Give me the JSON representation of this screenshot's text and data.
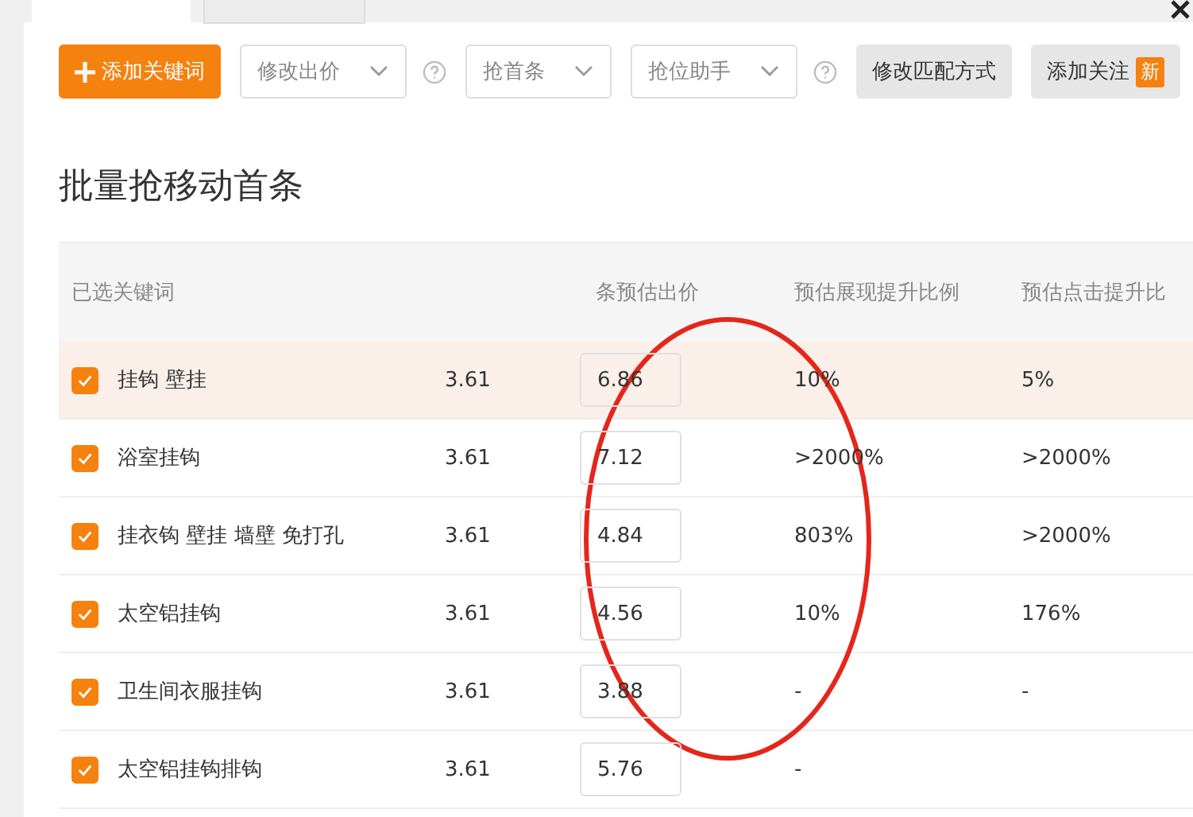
{
  "toolbar": {
    "add_button": "添加关键词",
    "dropdowns": [
      {
        "label": "修改出价",
        "help": true
      },
      {
        "label": "抢首条",
        "help": false
      },
      {
        "label": "抢位助手",
        "help": true
      }
    ],
    "buttons": [
      {
        "label": "修改匹配方式"
      },
      {
        "label": "添加关注",
        "badge": "新"
      }
    ]
  },
  "title": "批量抢移动首条",
  "table": {
    "columns": [
      "已选关键词",
      "",
      "条预估出价",
      "预估展现提升比例",
      "预估点击提升比"
    ],
    "rows": [
      {
        "keyword": "挂钩 壁挂",
        "price": "3.61",
        "bid": "6.86",
        "impression": "10%",
        "click": "5%",
        "checked": true,
        "highlighted": true
      },
      {
        "keyword": "浴室挂钩",
        "price": "3.61",
        "bid": "7.12",
        "impression": ">2000%",
        "click": ">2000%",
        "checked": true,
        "highlighted": false
      },
      {
        "keyword": "挂衣钩 壁挂 墙壁 免打孔",
        "price": "3.61",
        "bid": "4.84",
        "impression": "803%",
        "click": ">2000%",
        "checked": true,
        "highlighted": false
      },
      {
        "keyword": "太空铝挂钩",
        "price": "3.61",
        "bid": "4.56",
        "impression": "10%",
        "click": "176%",
        "checked": true,
        "highlighted": false
      },
      {
        "keyword": "卫生间衣服挂钩",
        "price": "3.61",
        "bid": "3.88",
        "impression": "-",
        "click": "-",
        "checked": true,
        "highlighted": false
      },
      {
        "keyword": "太空铝挂钩排钩",
        "price": "3.61",
        "bid": "5.76",
        "impression": "-",
        "checked": true,
        "highlighted": false
      }
    ]
  }
}
